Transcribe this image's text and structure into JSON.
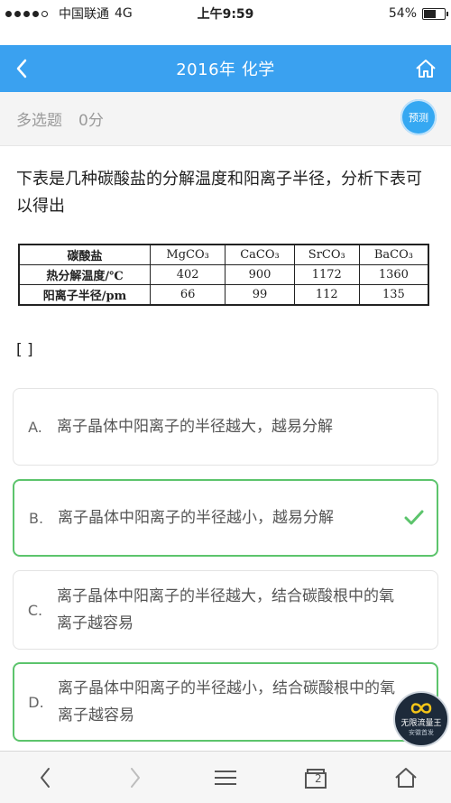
{
  "statusbar": {
    "carrier": "中国联通",
    "network": "4G",
    "time": "上午9:59",
    "battery": "54%"
  },
  "nav": {
    "title": "2016年 化学"
  },
  "question_header": {
    "type": "多选题",
    "score": "0分",
    "predict_label": "预测"
  },
  "question": {
    "text": "下表是几种碳酸盐的分解温度和阳离子半径，分析下表可以得出",
    "bracket": "[ ]"
  },
  "table": {
    "headers": [
      "碳酸盐",
      "MgCO₃",
      "CaCO₃",
      "SrCO₃",
      "BaCO₃"
    ],
    "rows": [
      [
        "热分解温度/℃",
        "402",
        "900",
        "1172",
        "1360"
      ],
      [
        "阳离子半径/pm",
        "66",
        "99",
        "112",
        "135"
      ]
    ]
  },
  "options": [
    {
      "letter": "A.",
      "text": "离子晶体中阳离子的半径越大，越易分解",
      "state": "normal"
    },
    {
      "letter": "B.",
      "text": "离子晶体中阳离子的半径越小，越易分解",
      "state": "correct"
    },
    {
      "letter": "C.",
      "text": "离子晶体中阳离子的半径越大，结合碳酸根中的氧离子越容易",
      "state": "normal"
    },
    {
      "letter": "D.",
      "text": "离子晶体中阳离子的半径越小，结合碳酸根中的氧离子越容易",
      "state": "correct"
    }
  ],
  "float_badge": {
    "line1": "无限流量王",
    "line2": "安徽首发"
  },
  "bottombar": {
    "tabs_count": "2"
  },
  "colors": {
    "nav_bg": "#3aa1f0",
    "correct": "#5cc46c",
    "predict_bg": "#35a8f2"
  }
}
